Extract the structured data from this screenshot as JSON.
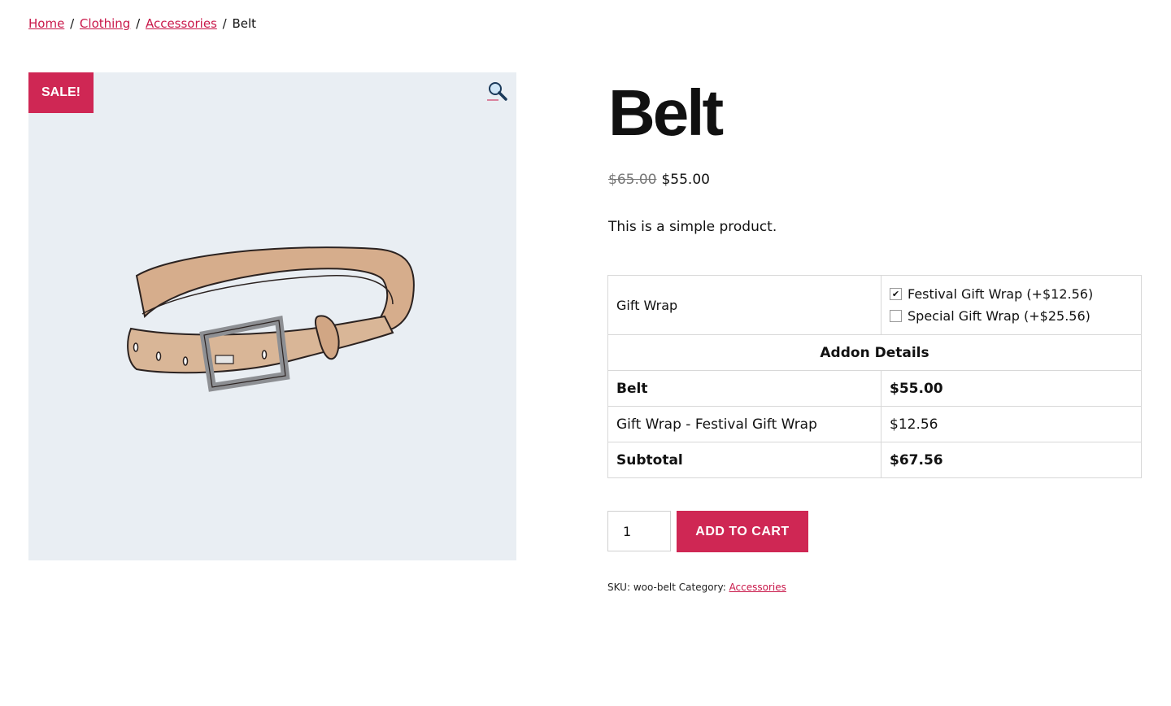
{
  "breadcrumb": {
    "home": "Home",
    "clothing": "Clothing",
    "accessories": "Accessories",
    "current": "Belt",
    "separator": "/"
  },
  "gallery": {
    "badge": "SALE!",
    "zoom_icon": "magnifier-icon"
  },
  "product": {
    "title": "Belt",
    "old_price": "$65.00",
    "price": "$55.00",
    "description": "This is a simple product."
  },
  "addons": {
    "label": "Gift Wrap",
    "options": [
      {
        "label": "Festival Gift Wrap (+$12.56)",
        "checked": true
      },
      {
        "label": "Special Gift Wrap (+$25.56)",
        "checked": false
      }
    ],
    "details_heading": "Addon Details",
    "rows": [
      {
        "name": "Belt",
        "value": "$55.00"
      },
      {
        "name": "Gift Wrap - Festival Gift Wrap",
        "value": "$12.56"
      },
      {
        "name": "Subtotal",
        "value": "$67.56"
      }
    ]
  },
  "cart": {
    "quantity": "1",
    "button": "ADD TO CART"
  },
  "meta": {
    "sku_label": "SKU:",
    "sku": "woo-belt",
    "category_label": "Category:",
    "category": "Accessories"
  },
  "colors": {
    "accent": "#cf2754",
    "link": "#c9184a",
    "image_bg": "#e9eef3"
  }
}
